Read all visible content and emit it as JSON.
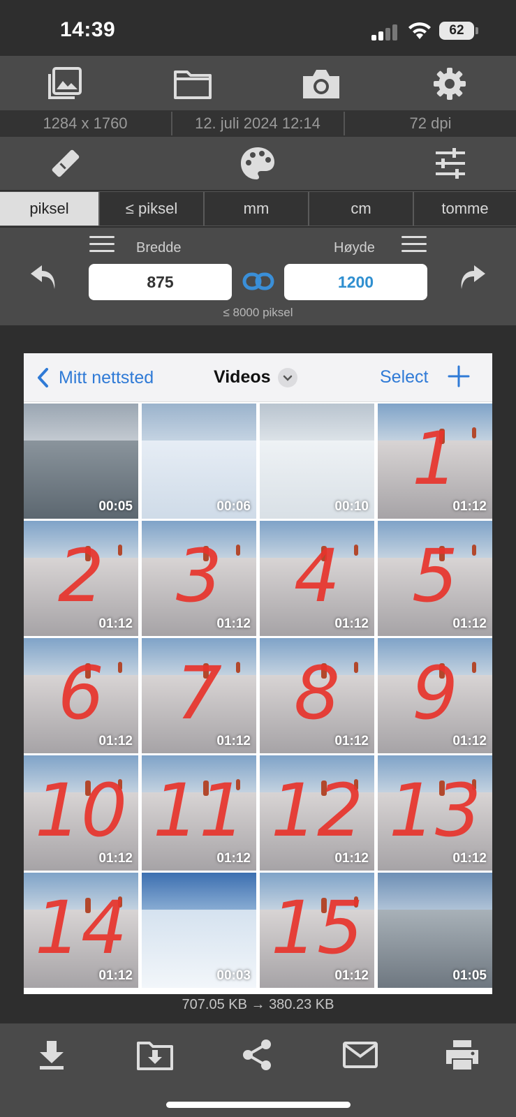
{
  "status": {
    "time": "14:39",
    "battery": "62"
  },
  "info": {
    "dimensions": "1284 x 1760",
    "date": "12. juli 2024 12:14",
    "dpi": "72 dpi"
  },
  "units": [
    {
      "label": "piksel",
      "active": true
    },
    {
      "label": "≤ piksel",
      "active": false
    },
    {
      "label": "mm",
      "active": false
    },
    {
      "label": "cm",
      "active": false
    },
    {
      "label": "tomme",
      "active": false
    }
  ],
  "size": {
    "width_label": "Bredde",
    "height_label": "Høyde",
    "width_value": "875",
    "height_value": "1200",
    "limit_hint": "≤ 8000 piksel"
  },
  "preview": {
    "back_label": "Mitt nettsted",
    "title": "Videos",
    "select_label": "Select",
    "items": [
      {
        "duration": "00:05",
        "number": ""
      },
      {
        "duration": "00:06",
        "number": ""
      },
      {
        "duration": "00:10",
        "number": ""
      },
      {
        "duration": "01:12",
        "number": "1"
      },
      {
        "duration": "01:12",
        "number": "2"
      },
      {
        "duration": "01:12",
        "number": "3"
      },
      {
        "duration": "01:12",
        "number": "4"
      },
      {
        "duration": "01:12",
        "number": "5"
      },
      {
        "duration": "01:12",
        "number": "6"
      },
      {
        "duration": "01:12",
        "number": "7"
      },
      {
        "duration": "01:12",
        "number": "8"
      },
      {
        "duration": "01:12",
        "number": "9"
      },
      {
        "duration": "01:12",
        "number": "10"
      },
      {
        "duration": "01:12",
        "number": "11"
      },
      {
        "duration": "01:12",
        "number": "12"
      },
      {
        "duration": "01:12",
        "number": "13"
      },
      {
        "duration": "01:12",
        "number": "14"
      },
      {
        "duration": "00:03",
        "number": ""
      },
      {
        "duration": "01:12",
        "number": "15"
      },
      {
        "duration": "01:05",
        "number": ""
      }
    ]
  },
  "file_sizes": {
    "original": "707.05 KB",
    "arrow": "→",
    "resized": "380.23 KB"
  },
  "colors": {
    "accent_blue": "#2f7ad6",
    "toolbar": "#4a4a4a",
    "number_red": "#e8342c"
  },
  "icons": {
    "top": [
      "photos-icon",
      "folder-icon",
      "camera-icon",
      "gear-icon"
    ],
    "middle": [
      "eraser-icon",
      "palette-icon",
      "sliders-icon"
    ],
    "bottom": [
      "download-icon",
      "save-to-folder-icon",
      "share-icon",
      "mail-icon",
      "print-icon"
    ]
  }
}
